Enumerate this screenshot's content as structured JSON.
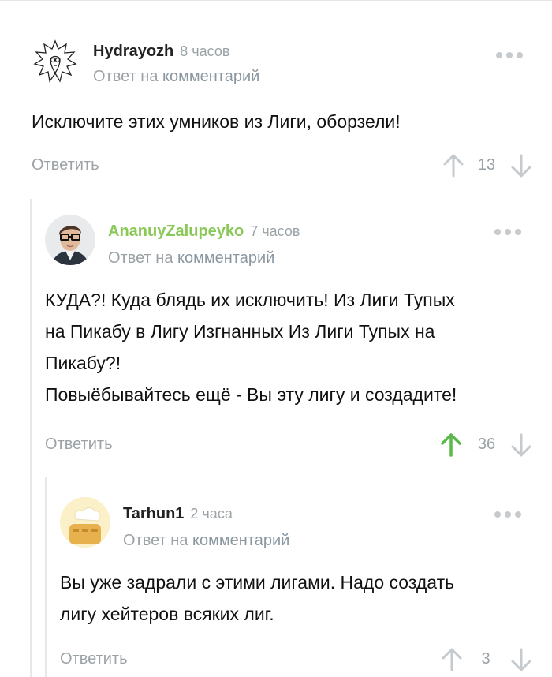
{
  "comments": [
    {
      "username": "Hydrayozh",
      "time": "8 часов",
      "reply_prefix": "Ответ на",
      "reply_link": "комментарий",
      "text_lines": [
        "Исключите этих умников из Лиги, оборзели!"
      ],
      "reply_button": "Ответить",
      "rating": "13",
      "upvoted": false,
      "avatar_icon": "sketch-avatar-icon"
    },
    {
      "username": "AnanuyZalupeyko",
      "time": "7 часов",
      "reply_prefix": "Ответ на",
      "reply_link": "комментарий",
      "text_lines": [
        "КУДА?! Куда блядь их исключить! Из Лиги Тупых",
        "на Пикабу в Лигу Изгнанных Из  Лиги Тупых на",
        "Пикабу?!",
        "Повыёбывайтесь ещё - Вы эту лигу и создадите!"
      ],
      "reply_button": "Ответить",
      "rating": "36",
      "upvoted": true,
      "avatar_icon": "man-with-glasses-avatar-icon"
    },
    {
      "username": "Tarhun1",
      "time": "2 часа",
      "reply_prefix": "Ответ на",
      "reply_link": "комментарий",
      "text_lines": [
        "Вы уже задрали с этими лигами. Надо создать",
        "лигу хейтеров всяких лиг."
      ],
      "reply_button": "Ответить",
      "rating": "3",
      "upvoted": false,
      "avatar_icon": "toaster-avatar-icon"
    }
  ],
  "colors": {
    "upvote_active": "#5bb84a",
    "arrow_inactive": "#c4cacd",
    "username_highlight": "#8ac858"
  }
}
